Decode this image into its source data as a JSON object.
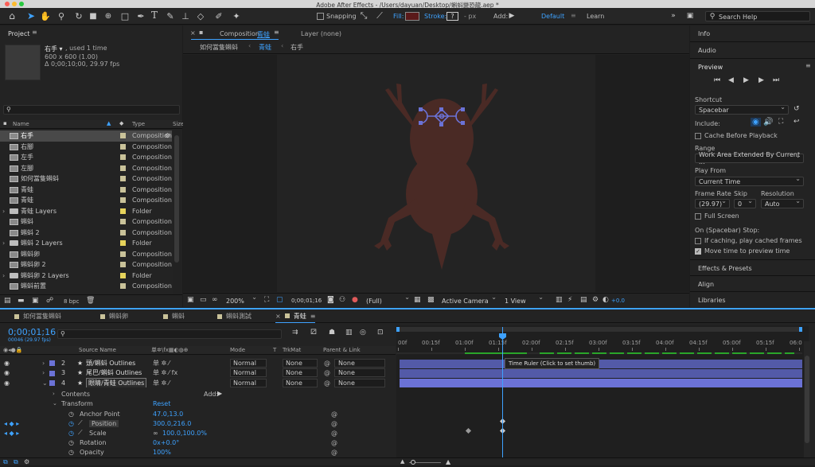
{
  "titlebar": {
    "title": "Adobe After Effects - /Users/dayuan/Desktop/蝌蚪變恐龍.aep *"
  },
  "toolbar": {
    "snapping": "Snapping",
    "fill": "Fill:",
    "stroke": "Stroke:",
    "stroke_val": "?",
    "px": "- px",
    "add": "Add:",
    "workspace_default": "Default",
    "workspace_learn": "Learn",
    "search_placeholder": "Search Help"
  },
  "project": {
    "title": "Project",
    "item_name": "右手 ▾",
    "item_used": ", used 1 time",
    "item_size": "600 x 600 (1.00)",
    "item_dur": "Δ 0;00;10;00, 29.97 fps",
    "col_name": "Name",
    "col_type": "Type",
    "col_size": "Size",
    "items": [
      {
        "name": "右手",
        "type": "Composition",
        "kind": "comp",
        "selected": true,
        "color": "#c9c299",
        "flow": true
      },
      {
        "name": "右腳",
        "type": "Composition",
        "kind": "comp",
        "color": "#c9c299"
      },
      {
        "name": "左手",
        "type": "Composition",
        "kind": "comp",
        "color": "#c9c299"
      },
      {
        "name": "左腳",
        "type": "Composition",
        "kind": "comp",
        "color": "#c9c299"
      },
      {
        "name": "如何當隻蝌蚪",
        "type": "Composition",
        "kind": "comp",
        "color": "#c9c299"
      },
      {
        "name": "青蛙",
        "type": "Composition",
        "kind": "comp",
        "color": "#c9c299"
      },
      {
        "name": "青蛙",
        "type": "Composition",
        "kind": "comp",
        "color": "#c9c299"
      },
      {
        "name": "青蛙 Layers",
        "type": "Folder",
        "kind": "folder",
        "color": "#e6d35b"
      },
      {
        "name": "蝌蚪",
        "type": "Composition",
        "kind": "comp",
        "color": "#c9c299"
      },
      {
        "name": "蝌蚪 2",
        "type": "Composition",
        "kind": "comp",
        "color": "#c9c299"
      },
      {
        "name": "蝌蚪 2 Layers",
        "type": "Folder",
        "kind": "folder",
        "color": "#e6d35b"
      },
      {
        "name": "蝌蚪卵",
        "type": "Composition",
        "kind": "comp",
        "color": "#c9c299"
      },
      {
        "name": "蝌蚪卵 2",
        "type": "Composition",
        "kind": "comp",
        "color": "#c9c299"
      },
      {
        "name": "蝌蚪卵 2 Layers",
        "type": "Folder",
        "kind": "folder",
        "color": "#e6d35b"
      },
      {
        "name": "蝌蚪前置",
        "type": "Composition",
        "kind": "comp",
        "color": "#c9c299"
      }
    ],
    "bpc": "8 bpc"
  },
  "comp": {
    "tab_label": "Composition",
    "tab_name": "青蛙",
    "layer_tab": "Layer (none)",
    "crumbs": [
      "如何當隻蝌蚪",
      "青蛙",
      "右手"
    ],
    "zoom": "200%",
    "timecode": "0;00;01;16",
    "quality": "(Full)",
    "camera": "Active Camera",
    "views": "1 View",
    "exposure": "+0.0"
  },
  "right": {
    "info": "Info",
    "audio": "Audio",
    "preview": "Preview",
    "shortcut_label": "Shortcut",
    "shortcut": "Spacebar",
    "include": "Include:",
    "cache_before": "Cache Before Playback",
    "range_label": "Range",
    "range": "Work Area Extended By Current ...",
    "playfrom_label": "Play From",
    "playfrom": "Current Time",
    "fr_label": "Frame Rate",
    "skip_label": "Skip",
    "res_label": "Resolution",
    "fr": "(29.97)",
    "skip": "0",
    "res": "Auto",
    "fullscreen": "Full Screen",
    "stop_label": "On (Spacebar) Stop:",
    "if_caching": "If caching, play cached frames",
    "move_time": "Move time to preview time",
    "effects": "Effects & Presets",
    "align": "Align",
    "libraries": "Libraries"
  },
  "timeline": {
    "tabs": [
      "如何當隻蝌蚪",
      "蝌蚪卵",
      "蝌蚪",
      "蝌蚪測試",
      "青蛙"
    ],
    "timecode": "0;00;01;16",
    "frames": "00046 (29.97 fps)",
    "cols": {
      "source": "Source Name",
      "mode": "Mode",
      "t": "T",
      "trkmat": "TrkMat",
      "parent": "Parent & Link"
    },
    "layers": [
      {
        "num": "2",
        "name": "頭/蝌蚪 Outlines",
        "mode": "Normal",
        "trk": "None",
        "parent": "None",
        "fx": false
      },
      {
        "num": "3",
        "name": "尾巴/蝌蚪 Outlines",
        "mode": "Normal",
        "trk": "None",
        "parent": "None",
        "fx": true
      },
      {
        "num": "4",
        "name": "眼睛/青蛙 Outlines",
        "mode": "Normal",
        "trk": "None",
        "parent": "None",
        "fx": false,
        "selected": true
      }
    ],
    "contents": "Contents",
    "add": "Add:",
    "transform": "Transform",
    "reset": "Reset",
    "props": [
      {
        "name": "Anchor Point",
        "val": "47.0,13.0"
      },
      {
        "name": "Position",
        "val": "300.0,216.0"
      },
      {
        "name": "Scale",
        "val": "100.0,100.0%"
      },
      {
        "name": "Rotation",
        "val": "0x+0.0°"
      },
      {
        "name": "Opacity",
        "val": "100%"
      }
    ],
    "ruler": [
      "00f",
      "00:15f",
      "01:00f",
      "01:15f",
      "02:00f",
      "02:15f",
      "03:00f",
      "03:15f",
      "04:00f",
      "04:15f",
      "05:00f",
      "05:15f",
      "06:0"
    ],
    "tooltip": "Time Ruler (Click to set thumb)"
  },
  "colors": {
    "accent": "#3ea2ff",
    "label_purple": "#6b72d6",
    "frog": "#4a2a25"
  }
}
